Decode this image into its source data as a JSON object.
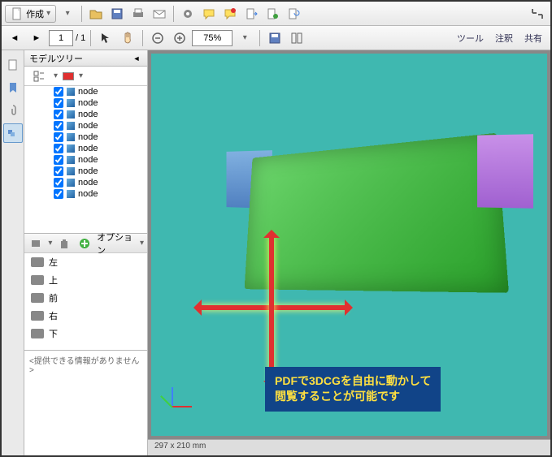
{
  "toolbar": {
    "create_label": "作成",
    "zoom_value": "75%",
    "page_current": "1",
    "page_total": "/ 1",
    "tool_link": "ツール",
    "annot_link": "注釈",
    "share_link": "共有"
  },
  "panel": {
    "title": "モデルツリー",
    "nodes": [
      "node",
      "node",
      "node",
      "node",
      "node",
      "node",
      "node",
      "node",
      "node",
      "node"
    ],
    "options_label": "オプション",
    "views": [
      {
        "label": "左"
      },
      {
        "label": "上"
      },
      {
        "label": "前"
      },
      {
        "label": "右"
      },
      {
        "label": "下"
      }
    ],
    "info_text": "<提供できる情報がありません>"
  },
  "viewport": {
    "callout_line1": "PDFで3DCGを自由に動かして",
    "callout_line2": "閲覧することが可能です",
    "status": "297 x 210 mm"
  }
}
